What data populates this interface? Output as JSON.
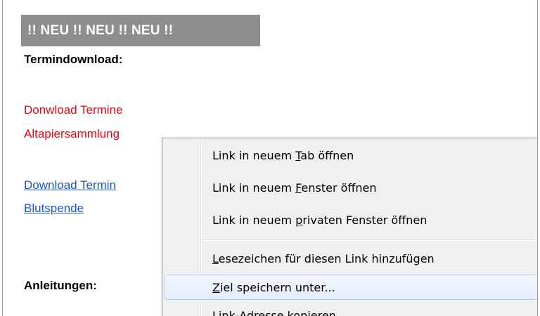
{
  "page": {
    "new_banner": "!! NEU !! NEU !! NEU !!",
    "termindownload_heading": "Termindownload:",
    "red_link_line1": "Donwload Termine",
    "red_link_line2": "Altapiersammlung",
    "blue_link_line1": "Download Termin",
    "blue_link_line2": "Blutspende",
    "anleitungen_heading": "Anleitungen:"
  },
  "context_menu": {
    "items": [
      {
        "before": "Link in neuem ",
        "mnemonic": "T",
        "after": "ab öffnen"
      },
      {
        "before": "Link in neuem ",
        "mnemonic": "F",
        "after": "enster öffnen"
      },
      {
        "before": "Link in neuem ",
        "mnemonic": "p",
        "after": "rivaten Fenster öffnen"
      },
      {
        "before": "",
        "mnemonic": "L",
        "after": "esezeichen für diesen Link hinzufügen"
      },
      {
        "before": "",
        "mnemonic": "Z",
        "after": "iel speichern unter..."
      },
      {
        "before": "Link-Adresse kopieren",
        "mnemonic": "",
        "after": ""
      }
    ],
    "hovered_index": 4
  }
}
